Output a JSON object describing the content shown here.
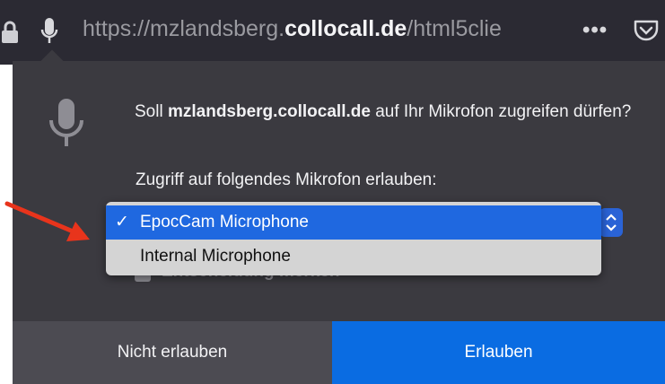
{
  "urlbar": {
    "url_prefix": "https://mzlandsberg.",
    "url_domain": "collocall.de",
    "url_suffix": "/html5clie",
    "more_label": "•••"
  },
  "prompt": {
    "intro": "Soll",
    "host": "mzlandsberg.collocall.de",
    "outro": "auf Ihr Mikrofon zugreifen dürfen?"
  },
  "device_label": "Zugriff auf folgendes Mikrofon erlauben:",
  "dropdown": {
    "selected": "EpocCam Microphone",
    "check": "✓",
    "options": [
      "EpocCam Microphone",
      "Internal Microphone"
    ]
  },
  "remember_label": "Entscheidung merken",
  "buttons": {
    "deny": "Nicht erlauben",
    "allow": "Erlauben"
  },
  "colors": {
    "allow": "#0a6ce2",
    "selection": "#1f68e0",
    "annotation_arrow": "#e8341c"
  },
  "icons": [
    "lock-icon",
    "microphone-icon",
    "more-icon",
    "pocket-icon",
    "annotation-arrow"
  ]
}
